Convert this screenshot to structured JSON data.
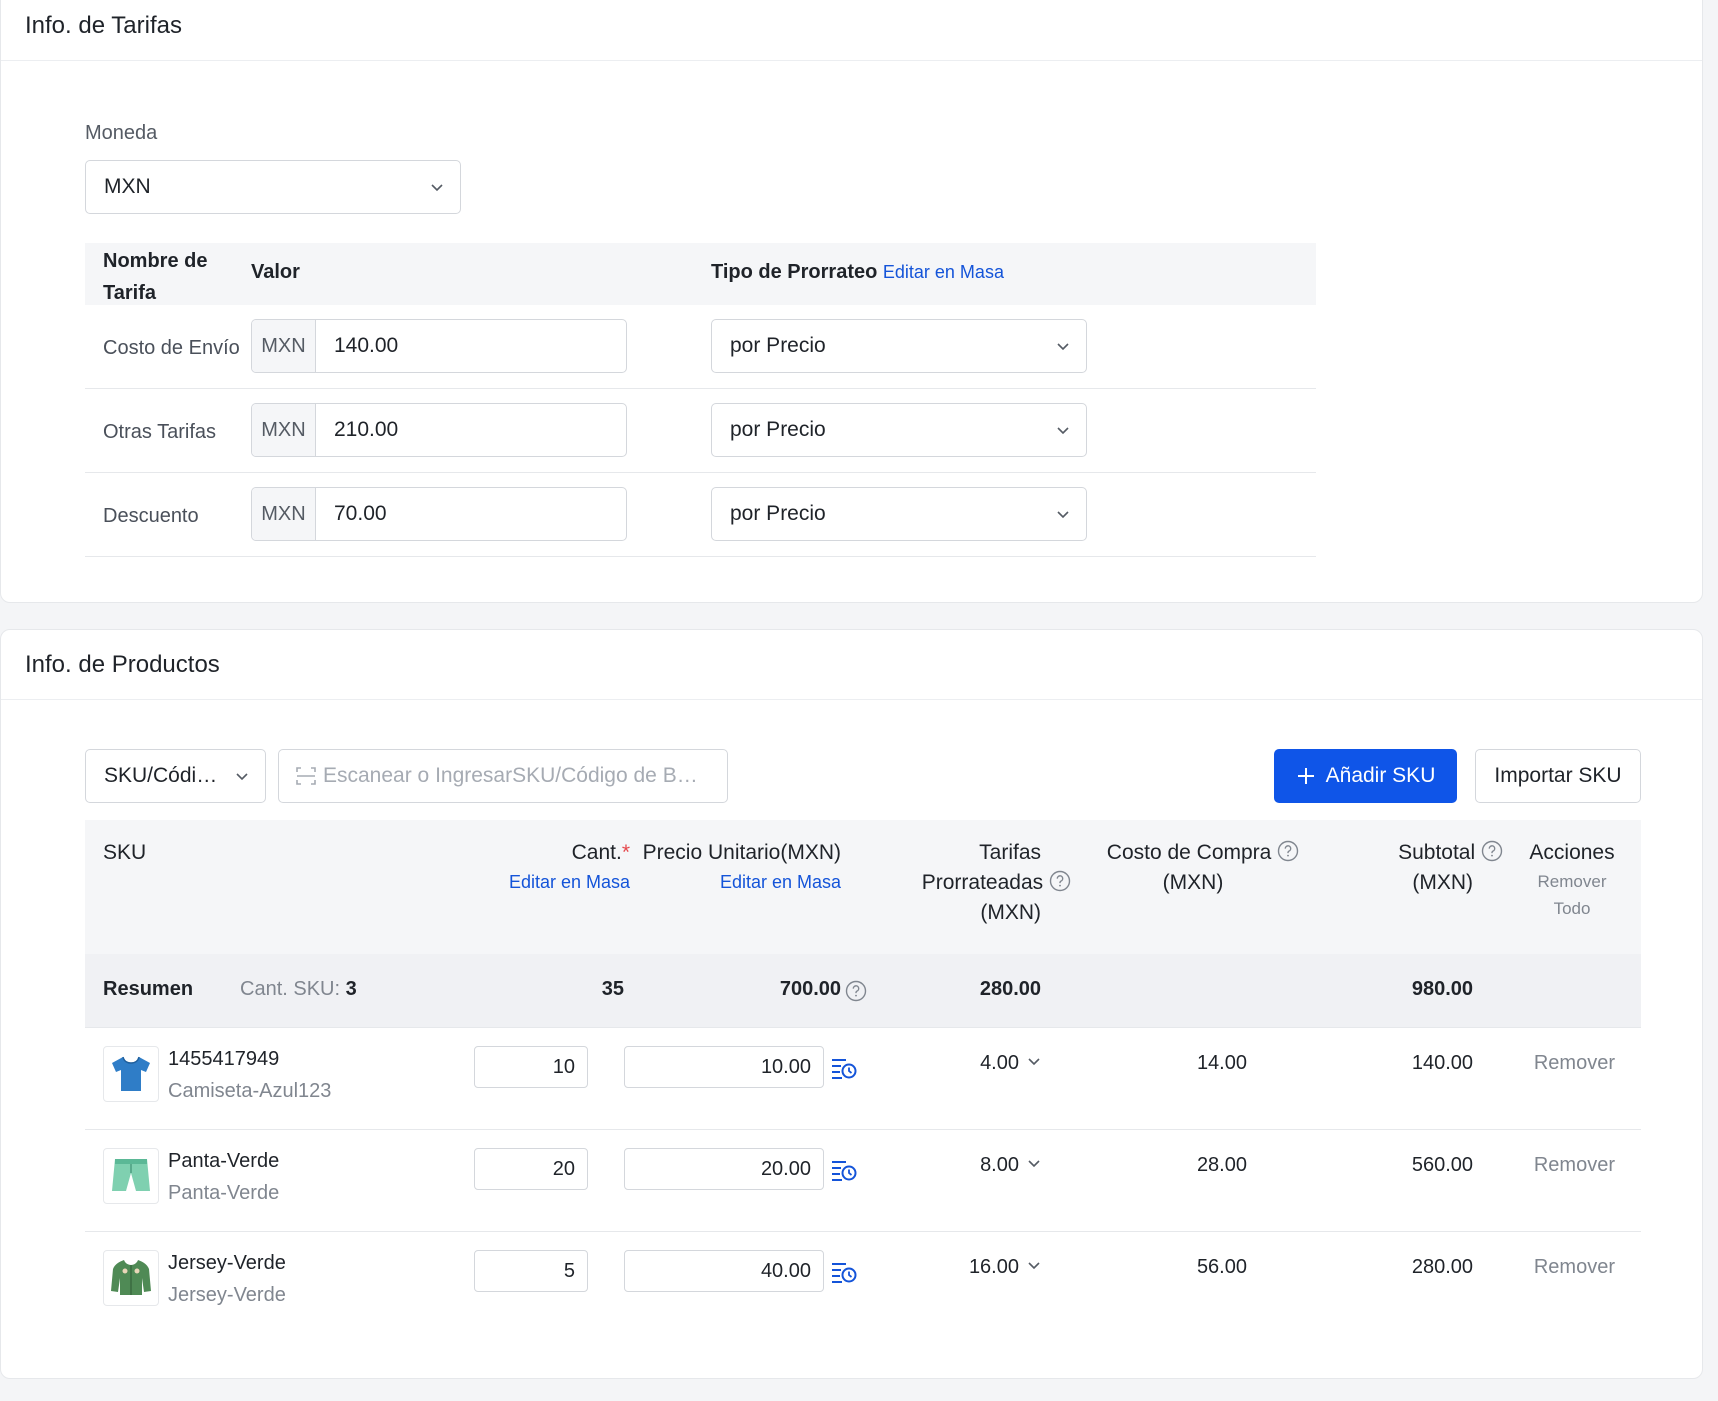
{
  "fees": {
    "title": "Info. de Tarifas",
    "currency_label": "Moneda",
    "currency_value": "MXN",
    "table_headers": {
      "name": "Nombre de Tarifa",
      "value": "Valor",
      "proration": "Tipo de Prorrateo",
      "bulk_edit": "Editar en Masa"
    },
    "rows": [
      {
        "name": "Costo de Envío",
        "currency": "MXN",
        "value": "140.00",
        "proration": "por Precio"
      },
      {
        "name": "Otras Tarifas",
        "currency": "MXN",
        "value": "210.00",
        "proration": "por Precio"
      },
      {
        "name": "Descuento",
        "currency": "MXN",
        "value": "70.00",
        "proration": "por Precio"
      }
    ]
  },
  "products": {
    "title": "Info. de Productos",
    "search_type": "SKU/Códi…",
    "scan_placeholder": "Escanear o IngresarSKU/Código de B…",
    "add_button": "Añadir SKU",
    "import_button": "Importar SKU",
    "headers": {
      "sku": "SKU",
      "qty": "Cant.",
      "qty_required_mark": "*",
      "qty_bulk": "Editar en Masa",
      "unit_price": "Precio Unitario(MXN)",
      "unit_price_bulk": "Editar en Masa",
      "prorated_line1": "Tarifas",
      "prorated_line2": "Prorrateadas",
      "prorated_line3": "(MXN)",
      "cost_line1": "Costo de Compra",
      "cost_line2": "(MXN)",
      "subtotal_line1": "Subtotal",
      "subtotal_line2": "(MXN)",
      "actions": "Acciones",
      "remove_all_line1": "Remover",
      "remove_all_line2": "Todo"
    },
    "summary": {
      "label": "Resumen",
      "sku_count_label": "Cant. SKU:",
      "sku_count": "3",
      "qty_total": "35",
      "price_total": "700.00",
      "prorated_total": "280.00",
      "subtotal_total": "980.00"
    },
    "rows": [
      {
        "sku": "1455417949",
        "name": "Camiseta-Azul123",
        "qty": "10",
        "unit_price": "10.00",
        "prorated": "4.00",
        "cost": "14.00",
        "subtotal": "140.00",
        "action": "Remover",
        "image": "blue-tshirt"
      },
      {
        "sku": "Panta-Verde",
        "name": "Panta-Verde",
        "qty": "20",
        "unit_price": "20.00",
        "prorated": "8.00",
        "cost": "28.00",
        "subtotal": "560.00",
        "action": "Remover",
        "image": "green-shorts"
      },
      {
        "sku": "Jersey-Verde",
        "name": "Jersey-Verde",
        "qty": "5",
        "unit_price": "40.00",
        "prorated": "16.00",
        "cost": "56.00",
        "subtotal": "280.00",
        "action": "Remover",
        "image": "green-jersey"
      }
    ]
  },
  "colors": {
    "primary": "#0f55e8",
    "link": "#1454d9",
    "required": "#e5484d",
    "header_bg": "#f5f6f8"
  }
}
